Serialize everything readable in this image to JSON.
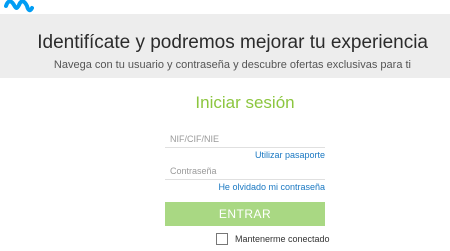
{
  "header": {
    "logo_name": "movistar-logo",
    "logo_color": "#019df4"
  },
  "hero": {
    "title": "Identifícate y podremos mejorar tu experiencia",
    "subtitle": "Navega con tu usuario y contraseña y descubre ofertas exclusivas para ti"
  },
  "login": {
    "title": "Iniciar sesión",
    "nif_placeholder": "NIF/CIF/NIE",
    "nif_value": "",
    "passport_link": "Utilizar pasaporte",
    "password_placeholder": "Contraseña",
    "password_value": "",
    "forgot_link": "He olvidado mi contraseña",
    "submit_label": "ENTRAR",
    "remember_label": "Mantenerme conectado",
    "remember_checked": false
  },
  "colors": {
    "accent_green": "#8cc63f",
    "button_green": "#a9d883",
    "link_blue": "#1a78c2"
  }
}
